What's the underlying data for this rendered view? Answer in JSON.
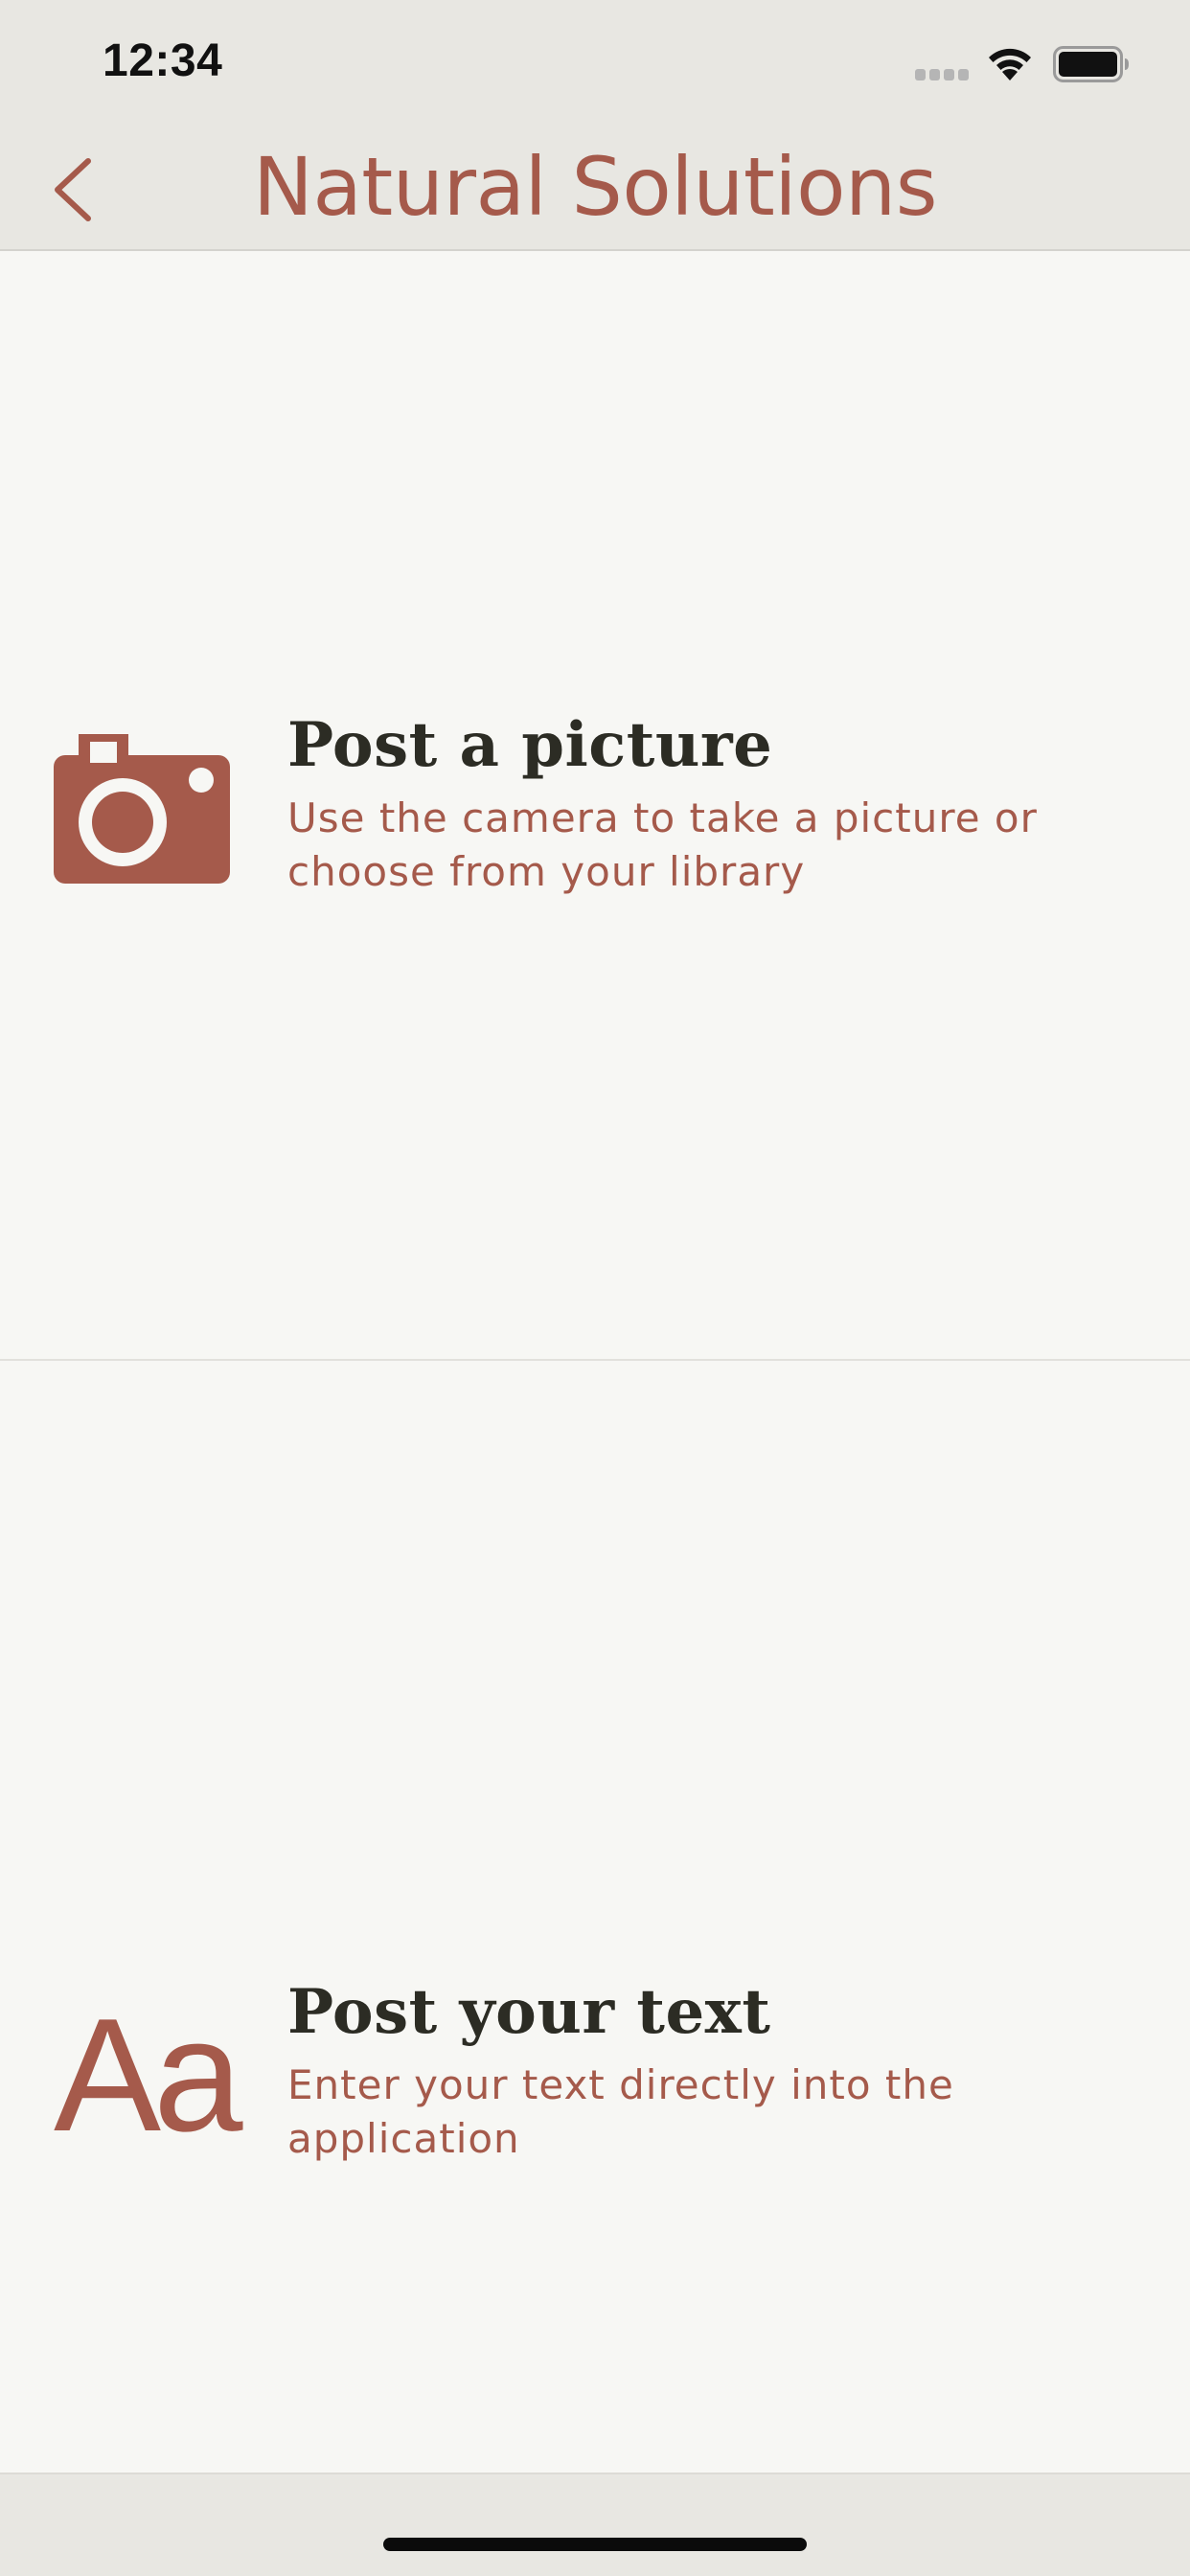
{
  "status_bar": {
    "time": "12:34"
  },
  "nav": {
    "title": "Natural Solutions"
  },
  "options": [
    {
      "title": "Post a picture",
      "description": "Use the camera to take a picture or choose from your library",
      "icon": "camera-icon"
    },
    {
      "title": "Post your text",
      "description": "Enter your text directly into the application",
      "icon": "text-aa-icon",
      "icon_glyph": "Aa"
    }
  ],
  "colors": {
    "accent": "#a55a4b",
    "background": "#f7f7f4",
    "chrome": "#e8e7e2",
    "title_text": "#2c2c24"
  }
}
